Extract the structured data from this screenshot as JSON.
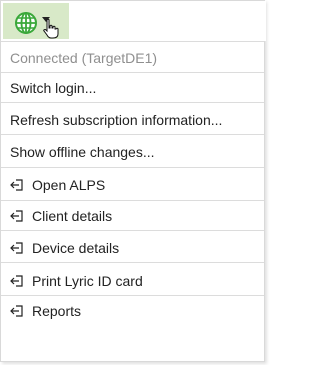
{
  "toolbar": {
    "globe_icon": "globe-icon",
    "dropdown_icon": "chevron-down-icon",
    "cursor_icon": "hand-cursor-icon",
    "accent_color": "#d8e9c8",
    "globe_color": "#3aa83a"
  },
  "status": {
    "connection_label": "Connected (TargetDE1)"
  },
  "menu": {
    "switch_login": "Switch login...",
    "refresh_subscription": "Refresh subscription information...",
    "show_offline_changes": "Show offline changes...",
    "open_items": [
      {
        "label": "Open ALPS",
        "icon": "open-external-icon"
      },
      {
        "label": "Client details",
        "icon": "open-external-icon"
      },
      {
        "label": "Device details",
        "icon": "open-external-icon"
      },
      {
        "label": "Print Lyric ID card",
        "icon": "open-external-icon"
      },
      {
        "label": "Reports",
        "icon": "open-external-icon"
      }
    ]
  }
}
